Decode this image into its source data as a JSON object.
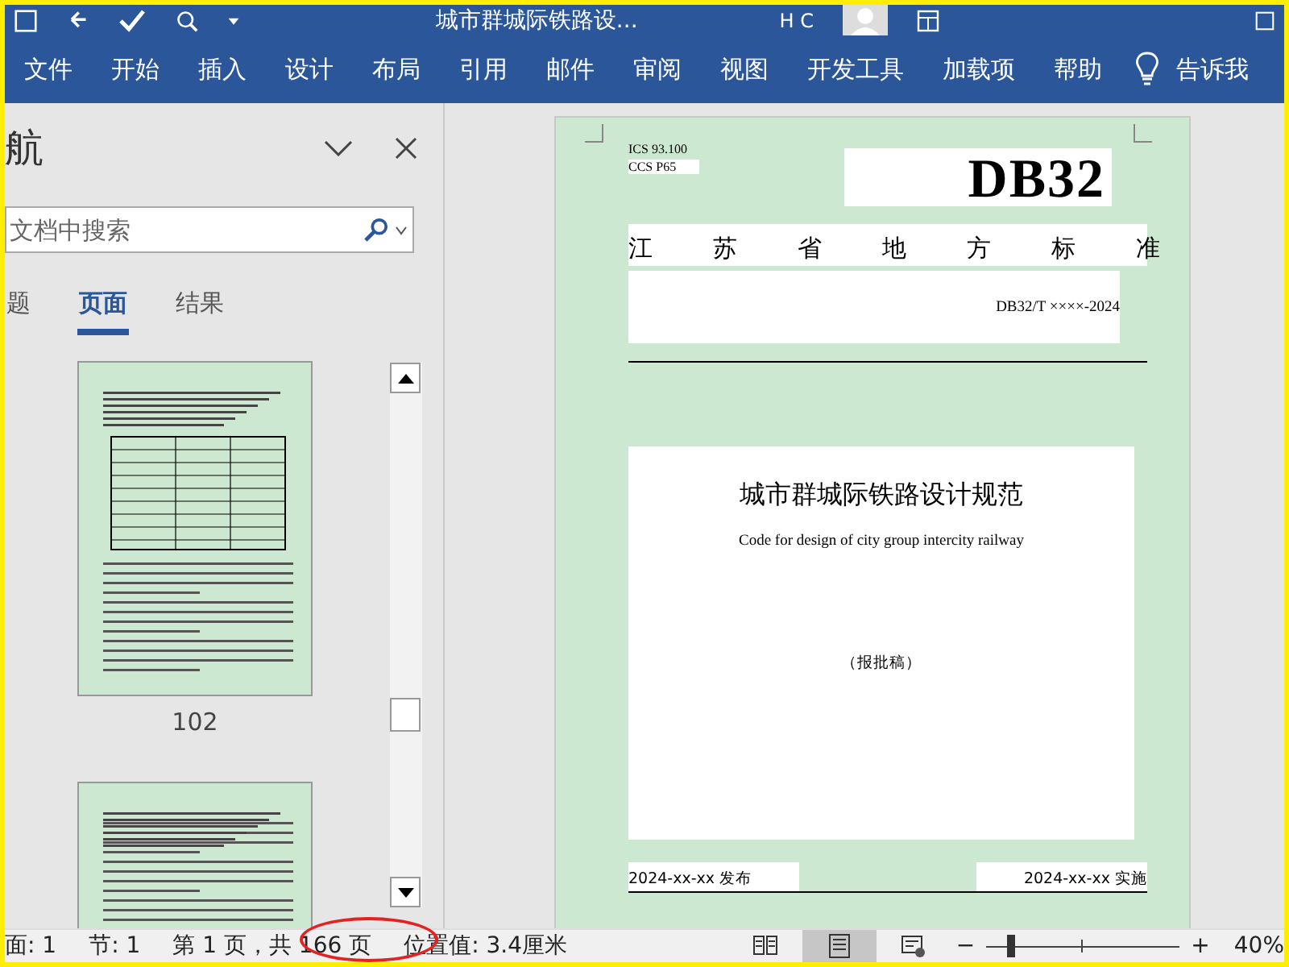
{
  "title_bar": {
    "title": "城市群城际铁路设...",
    "user": "H C"
  },
  "ribbon": {
    "tabs": [
      {
        "label": "文件",
        "selected": false
      },
      {
        "label": "开始",
        "selected": false
      },
      {
        "label": "插入",
        "selected": false
      },
      {
        "label": "设计",
        "selected": false
      },
      {
        "label": "布局",
        "selected": false
      },
      {
        "label": "引用",
        "selected": false
      },
      {
        "label": "邮件",
        "selected": false
      },
      {
        "label": "审阅",
        "selected": false
      },
      {
        "label": "视图",
        "selected": false
      },
      {
        "label": "开发工具",
        "selected": false
      },
      {
        "label": "加载项",
        "selected": false
      },
      {
        "label": "帮助",
        "selected": false
      }
    ],
    "tell_me": "告诉我"
  },
  "navigation": {
    "title": "航",
    "search": {
      "placeholder": "文档中搜索"
    },
    "tabs": [
      {
        "label": "题",
        "selected": false
      },
      {
        "label": "页面",
        "selected": true
      },
      {
        "label": "结果",
        "selected": false
      }
    ],
    "thumbnails": [
      {
        "page": "102",
        "selected": false
      },
      {
        "selected": false
      }
    ]
  },
  "document": {
    "ics": "ICS 93.100",
    "ccs": "CCS P65",
    "code": "DB32",
    "standard": "江苏省地方标准",
    "number": "DB32/T ××××-2024",
    "title_cn": "城市群城际铁路设计规范",
    "title_en": "Code for design of city group intercity railway",
    "draft": "（报批稿）",
    "publish": "2024-xx-xx 发布",
    "implement": "2024-xx-xx 实施"
  },
  "status_bar": {
    "items": [
      "面: 1",
      "节: 1",
      "第 1 页，共 166 页",
      "位置值: 3.4厘米"
    ],
    "views": [
      {
        "kind": "read",
        "selected": false
      },
      {
        "kind": "print",
        "selected": true
      },
      {
        "kind": "web",
        "selected": false
      }
    ],
    "zoom": {
      "minus": "−",
      "plus": "+",
      "level": 0.12,
      "reading": "40%"
    }
  }
}
